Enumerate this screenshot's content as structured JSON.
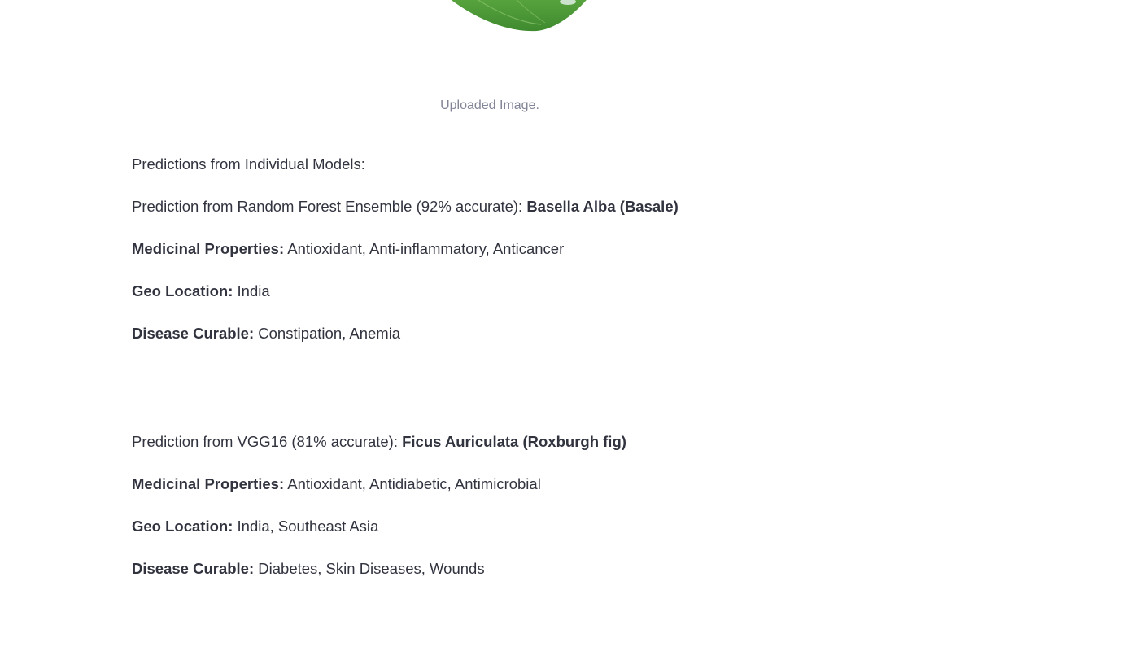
{
  "image": {
    "caption": "Uploaded Image."
  },
  "results": {
    "header": "Predictions from Individual Models:",
    "models": [
      {
        "prefix": "Prediction from Random Forest Ensemble (92% accurate): ",
        "plant": "Basella Alba (Basale)",
        "medicinal_label": "Medicinal Properties:",
        "medicinal_value": " Antioxidant, Anti-inflammatory, Anticancer",
        "geo_label": "Geo Location:",
        "geo_value": " India",
        "disease_label": "Disease Curable:",
        "disease_value": " Constipation, Anemia"
      },
      {
        "prefix": "Prediction from VGG16 (81% accurate): ",
        "plant": "Ficus Auriculata (Roxburgh fig)",
        "medicinal_label": "Medicinal Properties:",
        "medicinal_value": " Antioxidant, Antidiabetic, Antimicrobial",
        "geo_label": "Geo Location:",
        "geo_value": " India, Southeast Asia",
        "disease_label": "Disease Curable:",
        "disease_value": " Diabetes, Skin Diseases, Wounds"
      }
    ]
  },
  "colors": {
    "text": "#31333f",
    "caption": "#808495",
    "leaf": "#4f9a3a",
    "divider": "#d6d6d9"
  }
}
